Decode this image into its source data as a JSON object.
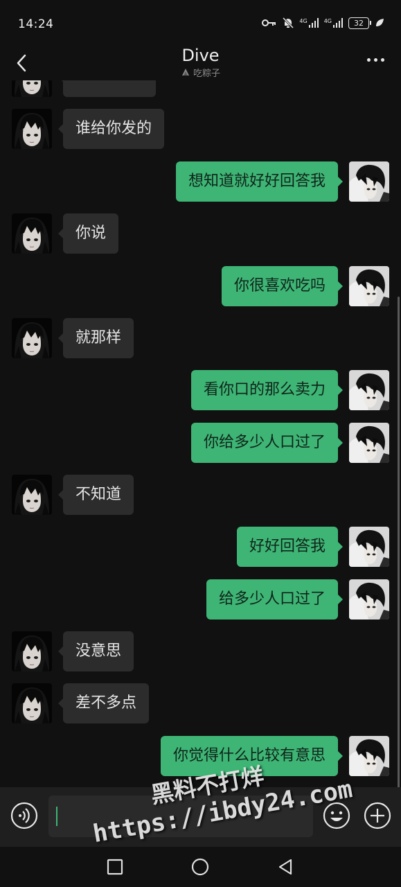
{
  "status_bar": {
    "time": "14:24",
    "network_1": "4G",
    "network_2": "4G",
    "battery": "32"
  },
  "header": {
    "title": "Dive",
    "subtitle": "吃粽子"
  },
  "messages": [
    {
      "side": "right",
      "text": "想知道就好好回答我"
    },
    {
      "side": "left",
      "text": "你说"
    },
    {
      "side": "right",
      "text": "你很喜欢吃吗"
    },
    {
      "side": "left",
      "text": "就那样"
    },
    {
      "side": "right",
      "text": "看你口的那么卖力"
    },
    {
      "side": "right",
      "text": "你给多少人口过了"
    },
    {
      "side": "left",
      "text": "不知道"
    },
    {
      "side": "right",
      "text": "好好回答我"
    },
    {
      "side": "right",
      "text": "给多少人口过了"
    },
    {
      "side": "left",
      "text": "没意思"
    },
    {
      "side": "left",
      "text": "差不多点"
    },
    {
      "side": "right",
      "text": "你觉得什么比较有意思"
    }
  ],
  "partial_top_message": {
    "side": "left",
    "text": "谁给你发的"
  },
  "input": {
    "value": ""
  },
  "watermark": {
    "line1": "黑料不打烊",
    "line2": "https://ibdy24.com"
  },
  "colors": {
    "background": "#111111",
    "incoming_bubble": "#2c2c2c",
    "outgoing_bubble": "#3eb575"
  },
  "icons": {
    "back": "chevron-left-icon",
    "more": "more-dots-icon",
    "voice": "voice-icon",
    "emoji": "emoji-icon",
    "plus": "plus-icon",
    "nav_recent": "square-icon",
    "nav_home": "circle-icon",
    "nav_back": "triangle-back-icon"
  }
}
